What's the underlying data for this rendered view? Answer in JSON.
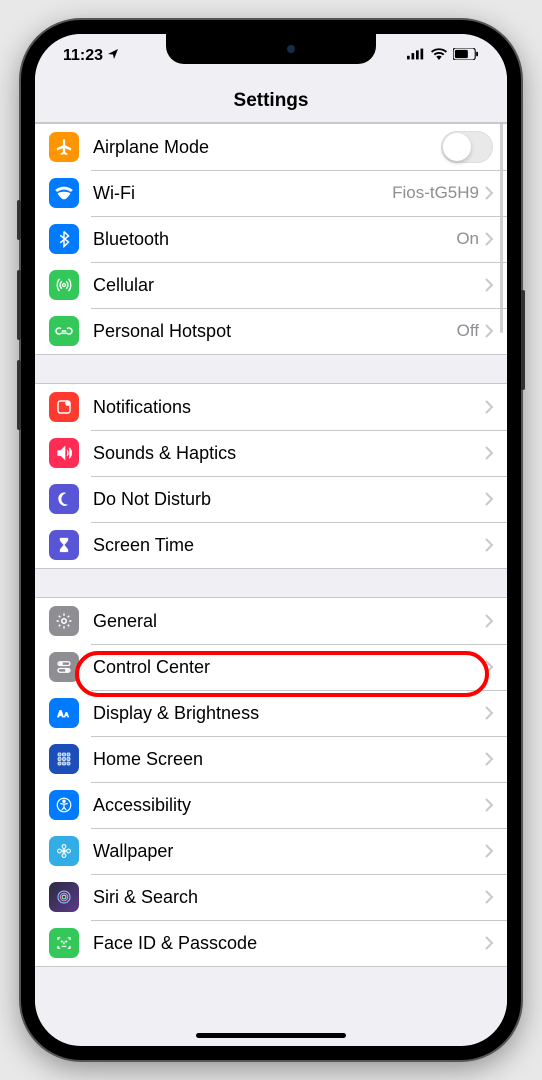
{
  "status": {
    "time": "11:23"
  },
  "header": {
    "title": "Settings"
  },
  "groups": [
    {
      "rows": [
        {
          "icon": "airplane",
          "bg": "bg-orange",
          "label": "Airplane Mode",
          "control": "toggle"
        },
        {
          "icon": "wifi",
          "bg": "bg-blue",
          "label": "Wi-Fi",
          "value": "Fios-tG5H9",
          "control": "disclosure"
        },
        {
          "icon": "bluetooth",
          "bg": "bg-blue",
          "label": "Bluetooth",
          "value": "On",
          "control": "disclosure"
        },
        {
          "icon": "cellular",
          "bg": "bg-green",
          "label": "Cellular",
          "control": "disclosure"
        },
        {
          "icon": "hotspot",
          "bg": "bg-green",
          "label": "Personal Hotspot",
          "value": "Off",
          "control": "disclosure"
        }
      ]
    },
    {
      "rows": [
        {
          "icon": "notifications",
          "bg": "bg-red",
          "label": "Notifications",
          "control": "disclosure"
        },
        {
          "icon": "sounds",
          "bg": "bg-pink",
          "label": "Sounds & Haptics",
          "control": "disclosure"
        },
        {
          "icon": "dnd",
          "bg": "bg-indigo",
          "label": "Do Not Disturb",
          "control": "disclosure"
        },
        {
          "icon": "screentime",
          "bg": "bg-indigo",
          "label": "Screen Time",
          "control": "disclosure"
        }
      ]
    },
    {
      "rows": [
        {
          "icon": "general",
          "bg": "bg-gray",
          "label": "General",
          "control": "disclosure",
          "highlighted": true
        },
        {
          "icon": "controlcenter",
          "bg": "bg-gray",
          "label": "Control Center",
          "control": "disclosure"
        },
        {
          "icon": "display",
          "bg": "bg-blue",
          "label": "Display & Brightness",
          "control": "disclosure"
        },
        {
          "icon": "homescreen",
          "bg": "bg-deepblue",
          "label": "Home Screen",
          "control": "disclosure"
        },
        {
          "icon": "accessibility",
          "bg": "bg-blue",
          "label": "Accessibility",
          "control": "disclosure"
        },
        {
          "icon": "wallpaper",
          "bg": "bg-teal",
          "label": "Wallpaper",
          "control": "disclosure"
        },
        {
          "icon": "siri",
          "bg": "bg-siri",
          "label": "Siri & Search",
          "control": "disclosure"
        },
        {
          "icon": "faceid",
          "bg": "bg-green",
          "label": "Face ID & Passcode",
          "control": "disclosure"
        }
      ]
    }
  ]
}
